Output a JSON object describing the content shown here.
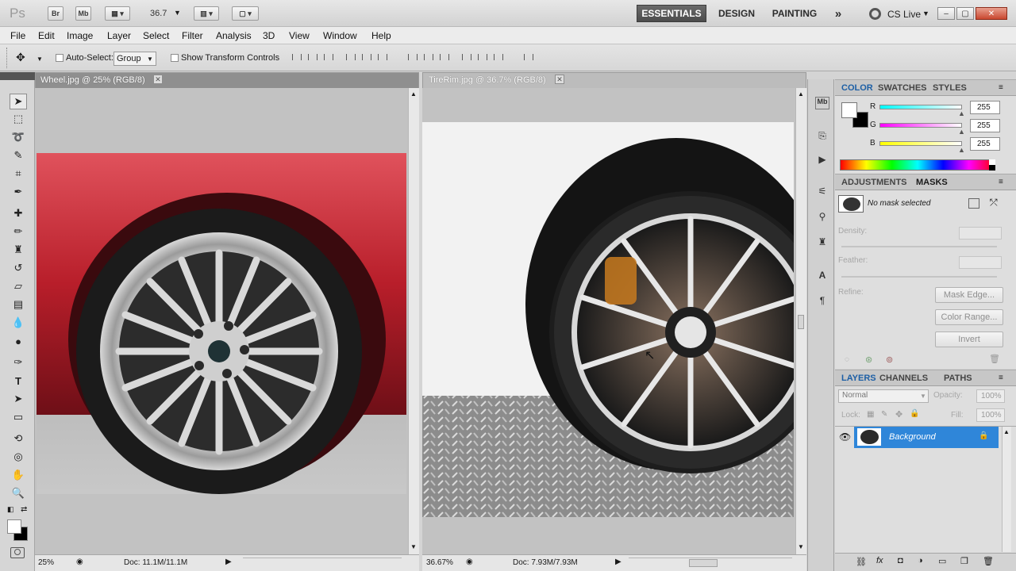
{
  "app": {
    "logo": "Ps"
  },
  "titlebar": {
    "buttons": [
      "Br",
      "Mb"
    ],
    "zoom": "36.7",
    "workspaces": [
      "ESSENTIALS",
      "DESIGN",
      "PAINTING"
    ],
    "more": "»",
    "cslive": "CS Live"
  },
  "menu": [
    "File",
    "Edit",
    "Image",
    "Layer",
    "Select",
    "Filter",
    "Analysis",
    "3D",
    "View",
    "Window",
    "Help"
  ],
  "options": {
    "auto_select_label": "Auto-Select:",
    "auto_select_value": "Group",
    "transform_label": "Show Transform Controls"
  },
  "docs": [
    {
      "title": "Wheel.jpg @ 25% (RGB/8)",
      "zoom": "25%",
      "info": "Doc: 11.1M/11.1M"
    },
    {
      "title": "TireRim.jpg @ 36.7% (RGB/8)",
      "zoom": "36.67%",
      "info": "Doc: 7.93M/7.93M"
    }
  ],
  "color_panel": {
    "tabs": [
      "COLOR",
      "SWATCHES",
      "STYLES"
    ],
    "channels": [
      {
        "label": "R",
        "value": "255"
      },
      {
        "label": "G",
        "value": "255"
      },
      {
        "label": "B",
        "value": "255"
      }
    ]
  },
  "masks_panel": {
    "tabs": [
      "ADJUSTMENTS",
      "MASKS"
    ],
    "status": "No mask selected",
    "density": "Density:",
    "feather": "Feather:",
    "refine": "Refine:",
    "buttons": [
      "Mask Edge...",
      "Color Range...",
      "Invert"
    ]
  },
  "layers_panel": {
    "tabs": [
      "LAYERS",
      "CHANNELS",
      "PATHS"
    ],
    "blend": "Normal",
    "opacity_label": "Opacity:",
    "opacity": "100%",
    "lock_label": "Lock:",
    "fill_label": "Fill:",
    "fill": "100%",
    "layer_name": "Background"
  }
}
